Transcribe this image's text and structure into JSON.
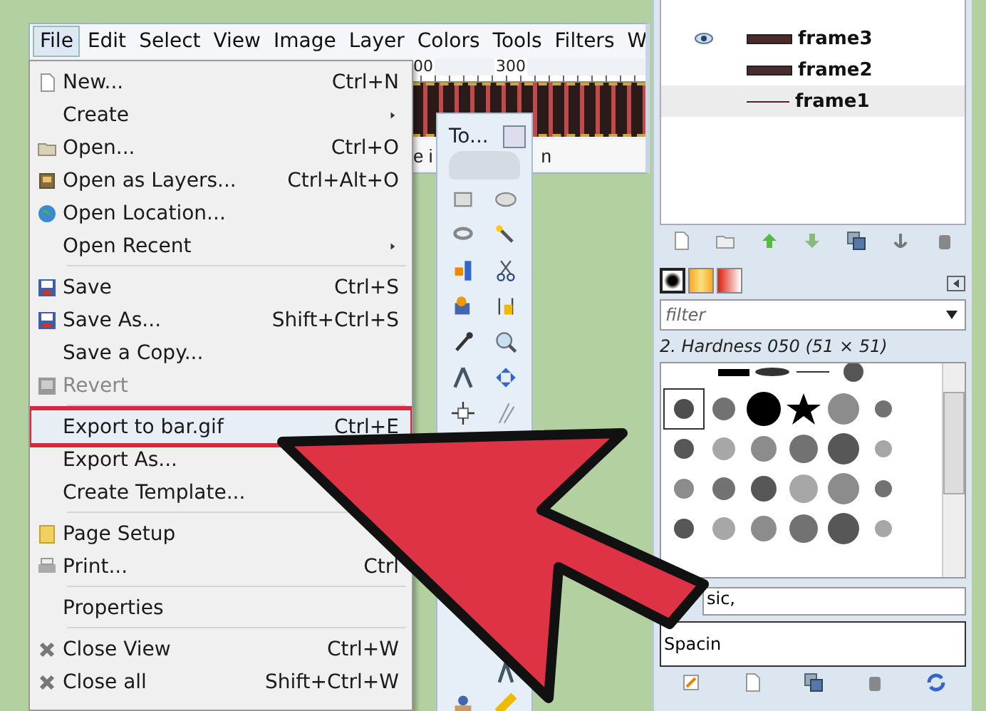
{
  "menubar": [
    {
      "label": "File",
      "selected": true
    },
    {
      "label": "Edit",
      "selected": false
    },
    {
      "label": "Select",
      "selected": false
    },
    {
      "label": "View",
      "selected": false
    },
    {
      "label": "Image",
      "selected": false
    },
    {
      "label": "Layer",
      "selected": false
    },
    {
      "label": "Colors",
      "selected": false
    },
    {
      "label": "Tools",
      "selected": false
    },
    {
      "label": "Filters",
      "selected": false
    },
    {
      "label": "W",
      "selected": false
    }
  ],
  "ruler": [
    "00",
    "300"
  ],
  "status_fragments": [
    "e i",
    "n"
  ],
  "toolbox": {
    "title": "To..."
  },
  "file_menu": [
    {
      "kind": "item",
      "label": "New...",
      "shortcut": "Ctrl+N",
      "disabled": false,
      "highlighted": false
    },
    {
      "kind": "submenu",
      "label": "Create",
      "disabled": false,
      "highlighted": false
    },
    {
      "kind": "item",
      "label": "Open...",
      "shortcut": "Ctrl+O",
      "disabled": false,
      "highlighted": false
    },
    {
      "kind": "item",
      "label": "Open as Layers...",
      "shortcut": "Ctrl+Alt+O",
      "disabled": false,
      "highlighted": false
    },
    {
      "kind": "item",
      "label": "Open Location...",
      "disabled": false,
      "highlighted": false
    },
    {
      "kind": "submenu",
      "label": "Open Recent",
      "disabled": false,
      "highlighted": false
    },
    {
      "kind": "separator"
    },
    {
      "kind": "item",
      "label": "Save",
      "shortcut": "Ctrl+S",
      "disabled": false,
      "highlighted": false
    },
    {
      "kind": "item",
      "label": "Save As...",
      "shortcut": "Shift+Ctrl+S",
      "disabled": false,
      "highlighted": false
    },
    {
      "kind": "item",
      "label": "Save a Copy...",
      "disabled": false,
      "highlighted": false
    },
    {
      "kind": "item",
      "label": "Revert",
      "disabled": true,
      "highlighted": false
    },
    {
      "kind": "separator"
    },
    {
      "kind": "item",
      "label": "Export to bar.gif",
      "shortcut": "Ctrl+E",
      "disabled": false,
      "highlighted": true
    },
    {
      "kind": "item",
      "label": "Export As...",
      "disabled": false,
      "highlighted": false
    },
    {
      "kind": "item",
      "label": "Create Template...",
      "disabled": false,
      "highlighted": false
    },
    {
      "kind": "separator"
    },
    {
      "kind": "item",
      "label": "Page Setup",
      "disabled": false,
      "highlighted": false
    },
    {
      "kind": "item",
      "label": "Print...",
      "shortcut": "Ctrl",
      "disabled": false,
      "highlighted": false
    },
    {
      "kind": "separator"
    },
    {
      "kind": "item",
      "label": "Properties",
      "disabled": false,
      "highlighted": false
    },
    {
      "kind": "separator"
    },
    {
      "kind": "item",
      "label": "Close View",
      "shortcut": "Ctrl+W",
      "disabled": false,
      "highlighted": false
    },
    {
      "kind": "item",
      "label": "Close all",
      "shortcut": "Shift+Ctrl+W",
      "disabled": false,
      "highlighted": false
    }
  ],
  "layers": [
    {
      "name": "frame3",
      "visible": true,
      "selected": false,
      "kind": "thick"
    },
    {
      "name": "frame2",
      "visible": false,
      "selected": false,
      "kind": "thick"
    },
    {
      "name": "frame1",
      "visible": false,
      "selected": true,
      "kind": "thin"
    }
  ],
  "brush_tabs": [
    {
      "kind": "brush",
      "selected": true
    },
    {
      "kind": "gradient-orange",
      "selected": false
    },
    {
      "kind": "gradient-red",
      "selected": false
    }
  ],
  "brushes": {
    "filter_placeholder": "filter",
    "current": "2. Hardness 050 (51 × 51)",
    "tag_fragment": "sic,",
    "spacing_fragment": "Spacin"
  }
}
